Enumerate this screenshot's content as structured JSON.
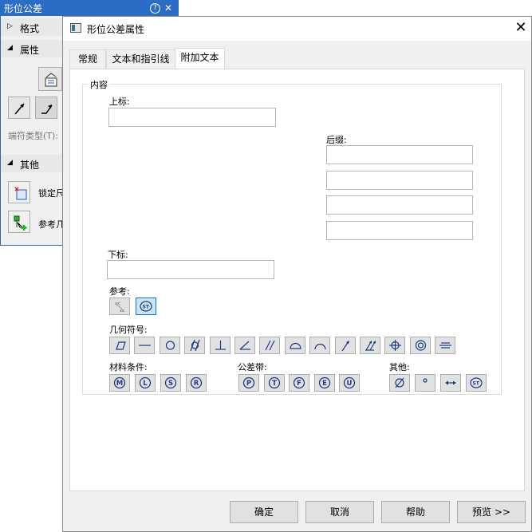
{
  "panel": {
    "title": "形位公差",
    "help_icon": "?",
    "close_icon": "✕",
    "sections": {
      "format": "格式",
      "properties": "属性",
      "other": "其他"
    },
    "end_symbol_label": "端符类型(T):",
    "lock_label": "锁定尺",
    "reference_label": "参考几"
  },
  "dialog": {
    "title": "形位公差属性",
    "tabs": [
      "常规",
      "文本和指引线",
      "附加文本"
    ],
    "active_tab": 2,
    "group_label": "内容",
    "superscript_label": "上标:",
    "superscript_value": "",
    "suffix_label": "后缀:",
    "suffix_values": [
      "",
      "",
      "",
      ""
    ],
    "subscript_label": "下标:",
    "subscript_value": "",
    "reference_label": "参考:",
    "geometric_label": "几何符号:",
    "material_label": "材料条件:",
    "tolerance_zone_label": "公差带:",
    "other_label": "其他:",
    "geometric_symbols": [
      "flatness",
      "straightness",
      "circularity",
      "cylindricity",
      "perpendicularity",
      "angularity",
      "parallelism",
      "surface-profile",
      "line-profile",
      "circular-runout",
      "total-runout",
      "position",
      "concentricity",
      "symmetry"
    ],
    "material_letters": [
      "M",
      "L",
      "S",
      "R"
    ],
    "tolerance_zone_letters": [
      "P",
      "T",
      "F",
      "E",
      "U"
    ],
    "other_symbols": {
      "diameter": "Ø",
      "degree": "°"
    },
    "buttons": {
      "ok": "确定",
      "cancel": "取消",
      "help": "帮助",
      "preview": "预览 >>"
    }
  },
  "colors": {
    "panel_title_bg": "#2b6cc4",
    "selected_button": "#cce4f7",
    "selected_border": "#0078d7",
    "symbol_blue": "#1a3a8a"
  }
}
